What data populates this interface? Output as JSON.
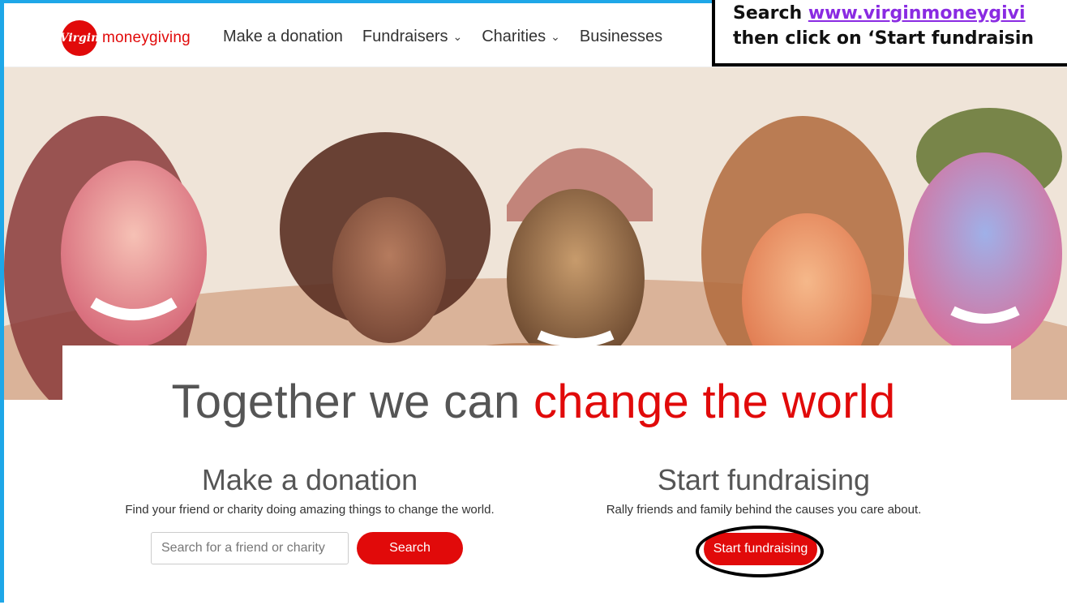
{
  "brand": {
    "badge": "Virgin",
    "name": "moneygiving"
  },
  "nav": {
    "items": [
      {
        "label": "Make a donation",
        "dropdown": false
      },
      {
        "label": "Fundraisers",
        "dropdown": true
      },
      {
        "label": "Charities",
        "dropdown": true
      },
      {
        "label": "Businesses",
        "dropdown": false
      }
    ]
  },
  "callout": {
    "line1_prefix": "Search ",
    "line1_link": "www.virginmoneygivi",
    "line2": "then click on ‘Start fundraisin"
  },
  "hero": {
    "headline_part1": "Together we can ",
    "headline_part2": "change the world"
  },
  "donate": {
    "title": "Make a donation",
    "subtitle": "Find your friend or charity doing amazing things to change the world.",
    "search_placeholder": "Search for a friend or charity",
    "search_button": "Search"
  },
  "fundraise": {
    "title": "Start fundraising",
    "subtitle": "Rally friends and family behind the causes you care about.",
    "button": "Start fundraising"
  },
  "colors": {
    "accent": "#e10a0a",
    "frame": "#1ea7e8",
    "link": "#8a2be2"
  }
}
